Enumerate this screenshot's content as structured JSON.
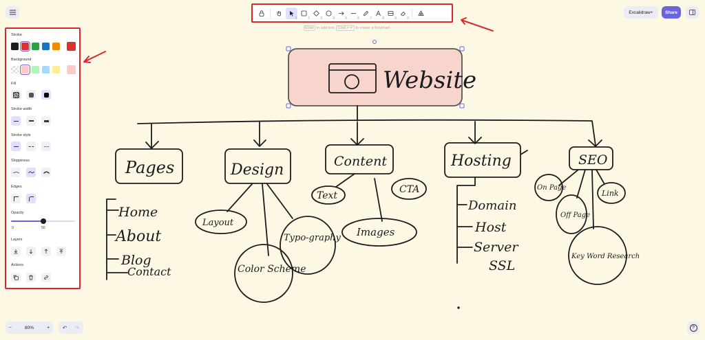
{
  "toolbar": {
    "tools": [
      {
        "name": "lock",
        "num": ""
      },
      {
        "name": "hand",
        "num": ""
      },
      {
        "name": "selection",
        "num": "1"
      },
      {
        "name": "rectangle",
        "num": "2"
      },
      {
        "name": "diamond",
        "num": "3"
      },
      {
        "name": "ellipse",
        "num": "4"
      },
      {
        "name": "arrow",
        "num": "5"
      },
      {
        "name": "line",
        "num": "6"
      },
      {
        "name": "draw",
        "num": "7"
      },
      {
        "name": "text",
        "num": "8"
      },
      {
        "name": "image",
        "num": "9"
      },
      {
        "name": "eraser",
        "num": "0"
      },
      {
        "name": "more-tools",
        "num": ""
      }
    ],
    "hint_key1": "Enter",
    "hint_text1": " to add text, ",
    "hint_key2": "Cmd + ↵",
    "hint_text2": " to create a flowchart"
  },
  "header": {
    "library_label": "Excalidraw+",
    "share_label": "Share"
  },
  "panel": {
    "stroke_label": "Stroke",
    "stroke_colors": [
      "#1e1e1e",
      "#e03131",
      "#2f9e44",
      "#1971c2",
      "#f08c00"
    ],
    "stroke_current": "#e03131",
    "background_label": "Background",
    "background_colors": [
      "transparent",
      "#ffc9c9",
      "#b2f2bb",
      "#a5d8ff",
      "#ffec99"
    ],
    "background_current": "#ffc9c9",
    "fill_label": "Fill",
    "stroke_width_label": "Stroke width",
    "stroke_style_label": "Stroke style",
    "sloppiness_label": "Sloppiness",
    "edges_label": "Edges",
    "opacity_label": "Opacity",
    "opacity_min": "0",
    "opacity_value": "50",
    "opacity_fraction": 0.5,
    "layers_label": "Layers",
    "actions_label": "Actions"
  },
  "footer": {
    "zoom_out": "−",
    "zoom_level": "80%",
    "zoom_in": "+",
    "undo": "↶",
    "redo": "↷",
    "help": "?"
  },
  "canvas": {
    "root": "Website",
    "categories": [
      "Pages",
      "Design",
      "Content",
      "Hosting",
      "SEO"
    ],
    "pages_items": [
      "Home",
      "About",
      "Blog",
      "Contact"
    ],
    "design_items": [
      "Layout",
      "Color Scheme",
      "Typo-graphy"
    ],
    "content_items": [
      "Text",
      "CTA",
      "Images"
    ],
    "hosting_items": [
      "Domain",
      "Host",
      "Server",
      "SSL"
    ],
    "seo_items": [
      "On Page",
      "Off Page",
      "Link",
      "Key Word Research"
    ]
  }
}
